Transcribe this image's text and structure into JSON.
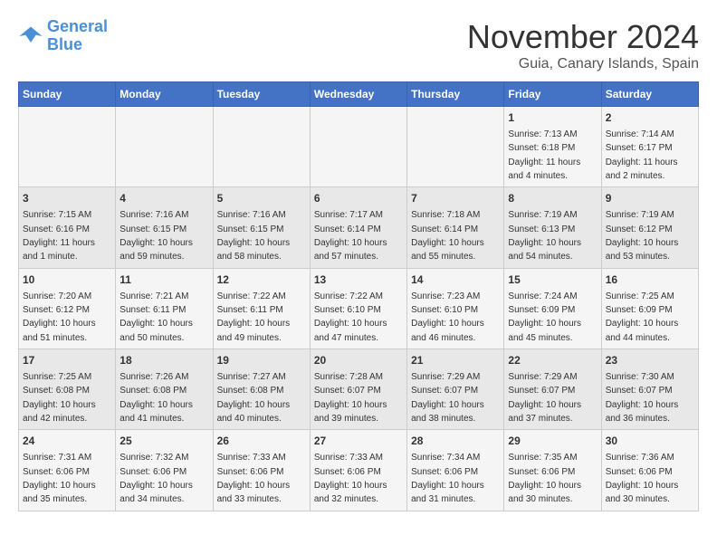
{
  "header": {
    "logo_line1": "General",
    "logo_line2": "Blue",
    "month": "November 2024",
    "location": "Guia, Canary Islands, Spain"
  },
  "days_of_week": [
    "Sunday",
    "Monday",
    "Tuesday",
    "Wednesday",
    "Thursday",
    "Friday",
    "Saturday"
  ],
  "weeks": [
    [
      {
        "day": "",
        "info": ""
      },
      {
        "day": "",
        "info": ""
      },
      {
        "day": "",
        "info": ""
      },
      {
        "day": "",
        "info": ""
      },
      {
        "day": "",
        "info": ""
      },
      {
        "day": "1",
        "info": "Sunrise: 7:13 AM\nSunset: 6:18 PM\nDaylight: 11 hours and 4 minutes."
      },
      {
        "day": "2",
        "info": "Sunrise: 7:14 AM\nSunset: 6:17 PM\nDaylight: 11 hours and 2 minutes."
      }
    ],
    [
      {
        "day": "3",
        "info": "Sunrise: 7:15 AM\nSunset: 6:16 PM\nDaylight: 11 hours and 1 minute."
      },
      {
        "day": "4",
        "info": "Sunrise: 7:16 AM\nSunset: 6:15 PM\nDaylight: 10 hours and 59 minutes."
      },
      {
        "day": "5",
        "info": "Sunrise: 7:16 AM\nSunset: 6:15 PM\nDaylight: 10 hours and 58 minutes."
      },
      {
        "day": "6",
        "info": "Sunrise: 7:17 AM\nSunset: 6:14 PM\nDaylight: 10 hours and 57 minutes."
      },
      {
        "day": "7",
        "info": "Sunrise: 7:18 AM\nSunset: 6:14 PM\nDaylight: 10 hours and 55 minutes."
      },
      {
        "day": "8",
        "info": "Sunrise: 7:19 AM\nSunset: 6:13 PM\nDaylight: 10 hours and 54 minutes."
      },
      {
        "day": "9",
        "info": "Sunrise: 7:19 AM\nSunset: 6:12 PM\nDaylight: 10 hours and 53 minutes."
      }
    ],
    [
      {
        "day": "10",
        "info": "Sunrise: 7:20 AM\nSunset: 6:12 PM\nDaylight: 10 hours and 51 minutes."
      },
      {
        "day": "11",
        "info": "Sunrise: 7:21 AM\nSunset: 6:11 PM\nDaylight: 10 hours and 50 minutes."
      },
      {
        "day": "12",
        "info": "Sunrise: 7:22 AM\nSunset: 6:11 PM\nDaylight: 10 hours and 49 minutes."
      },
      {
        "day": "13",
        "info": "Sunrise: 7:22 AM\nSunset: 6:10 PM\nDaylight: 10 hours and 47 minutes."
      },
      {
        "day": "14",
        "info": "Sunrise: 7:23 AM\nSunset: 6:10 PM\nDaylight: 10 hours and 46 minutes."
      },
      {
        "day": "15",
        "info": "Sunrise: 7:24 AM\nSunset: 6:09 PM\nDaylight: 10 hours and 45 minutes."
      },
      {
        "day": "16",
        "info": "Sunrise: 7:25 AM\nSunset: 6:09 PM\nDaylight: 10 hours and 44 minutes."
      }
    ],
    [
      {
        "day": "17",
        "info": "Sunrise: 7:25 AM\nSunset: 6:08 PM\nDaylight: 10 hours and 42 minutes."
      },
      {
        "day": "18",
        "info": "Sunrise: 7:26 AM\nSunset: 6:08 PM\nDaylight: 10 hours and 41 minutes."
      },
      {
        "day": "19",
        "info": "Sunrise: 7:27 AM\nSunset: 6:08 PM\nDaylight: 10 hours and 40 minutes."
      },
      {
        "day": "20",
        "info": "Sunrise: 7:28 AM\nSunset: 6:07 PM\nDaylight: 10 hours and 39 minutes."
      },
      {
        "day": "21",
        "info": "Sunrise: 7:29 AM\nSunset: 6:07 PM\nDaylight: 10 hours and 38 minutes."
      },
      {
        "day": "22",
        "info": "Sunrise: 7:29 AM\nSunset: 6:07 PM\nDaylight: 10 hours and 37 minutes."
      },
      {
        "day": "23",
        "info": "Sunrise: 7:30 AM\nSunset: 6:07 PM\nDaylight: 10 hours and 36 minutes."
      }
    ],
    [
      {
        "day": "24",
        "info": "Sunrise: 7:31 AM\nSunset: 6:06 PM\nDaylight: 10 hours and 35 minutes."
      },
      {
        "day": "25",
        "info": "Sunrise: 7:32 AM\nSunset: 6:06 PM\nDaylight: 10 hours and 34 minutes."
      },
      {
        "day": "26",
        "info": "Sunrise: 7:33 AM\nSunset: 6:06 PM\nDaylight: 10 hours and 33 minutes."
      },
      {
        "day": "27",
        "info": "Sunrise: 7:33 AM\nSunset: 6:06 PM\nDaylight: 10 hours and 32 minutes."
      },
      {
        "day": "28",
        "info": "Sunrise: 7:34 AM\nSunset: 6:06 PM\nDaylight: 10 hours and 31 minutes."
      },
      {
        "day": "29",
        "info": "Sunrise: 7:35 AM\nSunset: 6:06 PM\nDaylight: 10 hours and 30 minutes."
      },
      {
        "day": "30",
        "info": "Sunrise: 7:36 AM\nSunset: 6:06 PM\nDaylight: 10 hours and 30 minutes."
      }
    ]
  ]
}
